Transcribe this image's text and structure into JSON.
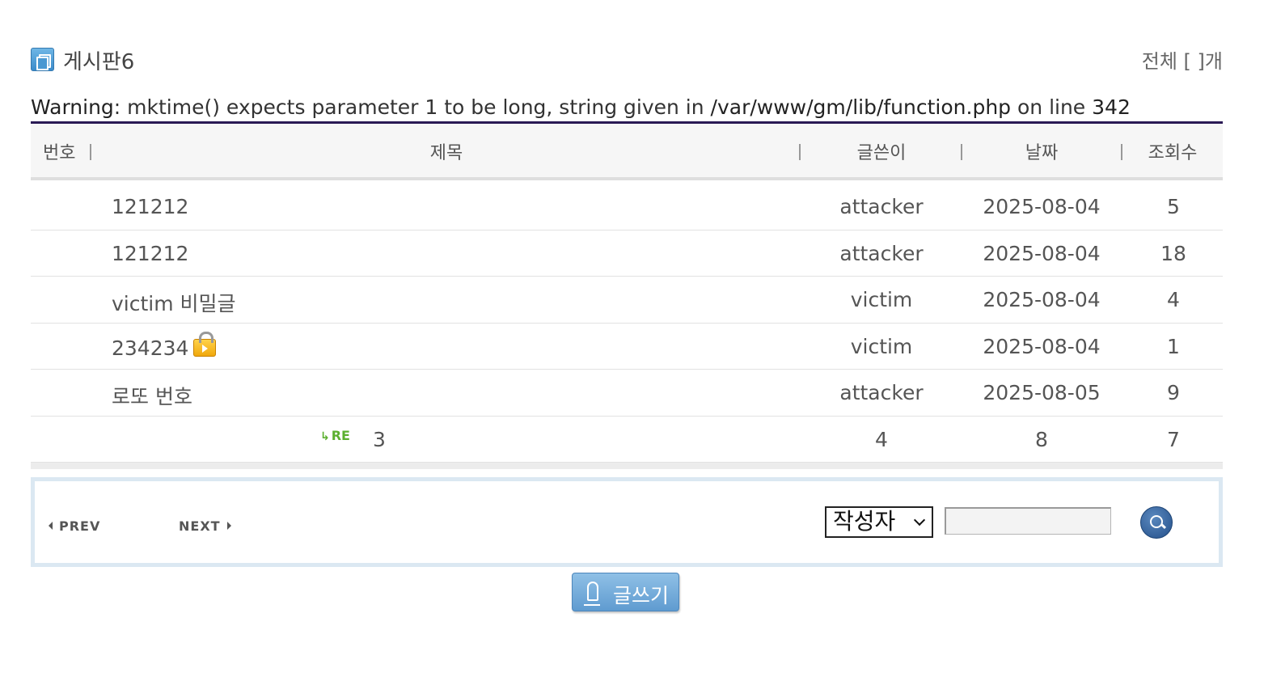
{
  "board": {
    "title": "게시판6",
    "total": "전체 [ ]개",
    "icon": "board-icon"
  },
  "warning": {
    "label": "Warning",
    "message": ": mktime() expects parameter 1 to be long, string given in ",
    "file": "/var/www/gm/lib/function.php",
    "on_line": " on line ",
    "line": "342"
  },
  "table": {
    "headers": {
      "no": "번호",
      "title": "제목",
      "author": "글쓴이",
      "date": "날짜",
      "views": "조회수"
    },
    "rows": [
      {
        "title": "121212",
        "author": "attacker",
        "date": "2025-08-04",
        "views": "5"
      },
      {
        "title": "121212",
        "author": "attacker",
        "date": "2025-08-04",
        "views": "18"
      },
      {
        "title": "victim 비밀글",
        "author": "victim",
        "date": "2025-08-04",
        "views": "4"
      },
      {
        "title": "234234",
        "author": "victim",
        "date": "2025-08-04",
        "views": "1",
        "icon": "lock-icon"
      },
      {
        "title": "로또 번호",
        "author": "attacker",
        "date": "2025-08-05",
        "views": "9"
      },
      {
        "reply_badge": "RE",
        "title": "3",
        "author": "4",
        "date": "8",
        "views": "7"
      }
    ]
  },
  "pager": {
    "prev_label": "PREV",
    "next_label": "NEXT"
  },
  "search": {
    "field_selected": "작성자",
    "query": "",
    "button_icon": "search-icon"
  },
  "write_button": {
    "label": "글쓰기",
    "icon": "pen-icon"
  },
  "colors": {
    "header_rule": "#2a1a55",
    "reply_badge": "#5cb030",
    "write_button": "#5f9bd0"
  }
}
